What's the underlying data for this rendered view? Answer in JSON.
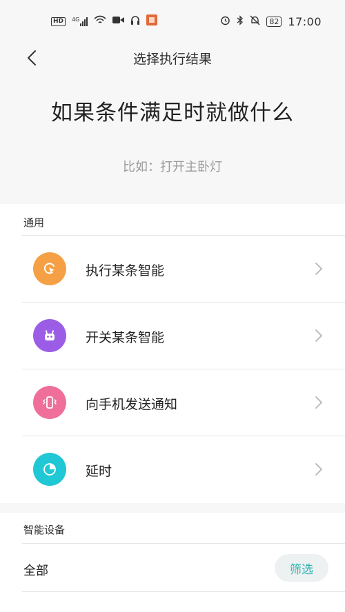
{
  "status_bar": {
    "left_icons": [
      "hd-icon",
      "4g-signal-icon",
      "wifi-icon",
      "video-icon",
      "headset-icon",
      "app-notification-icon"
    ],
    "hd_label": "HD",
    "net_label": "4G",
    "right_icons": [
      "alarm-icon",
      "bluetooth-icon",
      "mute-icon"
    ],
    "battery": "82",
    "time": "17:00"
  },
  "nav": {
    "title": "选择执行结果"
  },
  "hero": {
    "title": "如果条件满足时就做什么",
    "subtitle": "比如：打开主卧灯"
  },
  "general": {
    "section_label": "通用",
    "items": [
      {
        "label": "执行某条智能",
        "icon": "cursor-click-icon",
        "color": "#f5a045"
      },
      {
        "label": "开关某条智能",
        "icon": "robot-icon",
        "color": "#9b5de5"
      },
      {
        "label": "向手机发送通知",
        "icon": "phone-vibrate-icon",
        "color": "#ef6f9a"
      },
      {
        "label": "延时",
        "icon": "clock-icon",
        "color": "#1fc8d4"
      }
    ]
  },
  "devices": {
    "section_label": "智能设备",
    "all_label": "全部",
    "filter_label": "筛选"
  }
}
